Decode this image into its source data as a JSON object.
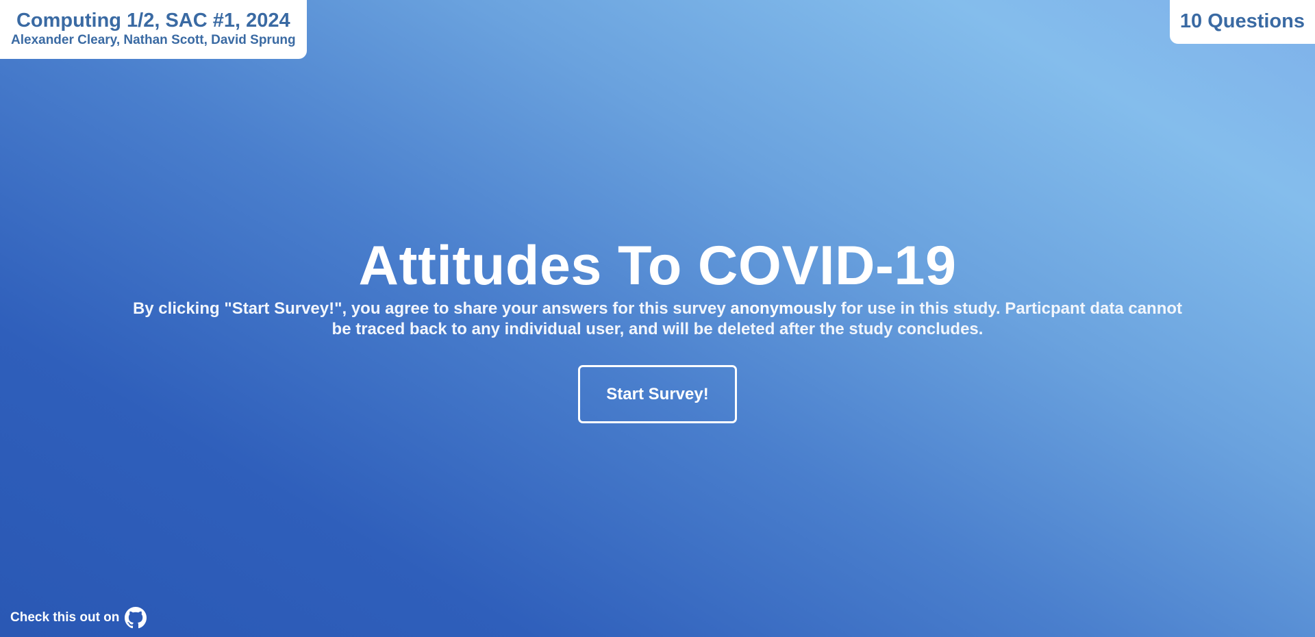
{
  "credits": {
    "title": "Computing 1/2, SAC #1, 2024",
    "authors": "Alexander Cleary, Nathan Scott, David Sprung"
  },
  "question_count": "10 Questions",
  "hero": {
    "title": "Attitudes To COVID-19",
    "disclaimer_before": "By clicking \"Start Survey!\", you agree to share your answers for this survey ",
    "disclaimer_emphasis": "anonymously",
    "disclaimer_after": " for use in this study. Particpant data cannot be traced back to any individual user, and will be deleted after the study concludes."
  },
  "start_button_label": "Start Survey!",
  "footer": {
    "github_text": "Check this out on",
    "icon": "github-icon"
  },
  "colors": {
    "card_text": "#3a6aa3",
    "gradient_dark": "#2a58b4",
    "gradient_light": "#84bdec"
  }
}
